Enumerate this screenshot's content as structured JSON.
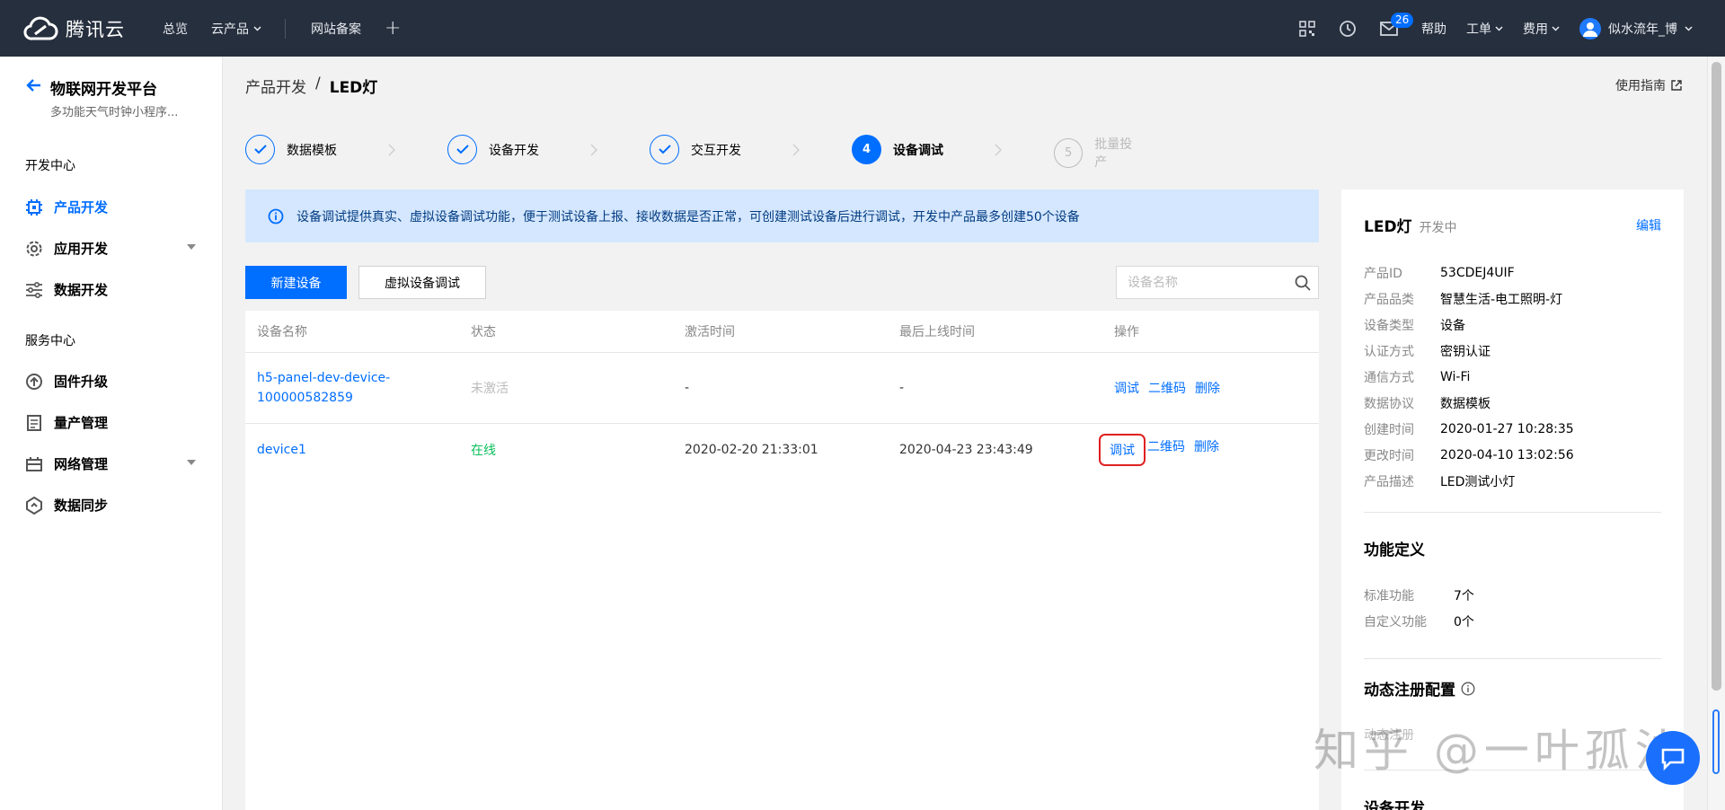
{
  "topbar": {
    "brand": "腾讯云",
    "nav": [
      "总览",
      "云产品",
      "网站备案"
    ],
    "mail_badge": "26",
    "help": "帮助",
    "ticket": "工单",
    "billing": "费用",
    "username": "似水流年_博"
  },
  "sidebar": {
    "title": "物联网开发平台",
    "subtitle": "多功能天气时钟小程序...",
    "section_dev": "开发中心",
    "items_dev": [
      "产品开发",
      "应用开发",
      "数据开发"
    ],
    "section_service": "服务中心",
    "items_service": [
      "固件升级",
      "量产管理",
      "网络管理",
      "数据同步"
    ]
  },
  "breadcrumb": {
    "parent": "产品开发",
    "sep": "/",
    "current": "LED灯"
  },
  "guide": "使用指南",
  "steps": [
    {
      "num": "1",
      "label": "数据模板",
      "state": "done"
    },
    {
      "num": "2",
      "label": "设备开发",
      "state": "done"
    },
    {
      "num": "3",
      "label": "交互开发",
      "state": "done"
    },
    {
      "num": "4",
      "label": "设备调试",
      "state": "current"
    },
    {
      "num": "5",
      "label": "批量投产",
      "state": "todo"
    }
  ],
  "notice": "设备调试提供真实、虚拟设备调试功能，便于测试设备上报、接收数据是否正常，可创建测试设备后进行调试，开发中产品最多创建50个设备",
  "buttons": {
    "new_device": "新建设备",
    "virtual_debug": "虚拟设备调试"
  },
  "search": {
    "placeholder": "设备名称",
    "value": ""
  },
  "table": {
    "columns": [
      "设备名称",
      "状态",
      "激活时间",
      "最后上线时间",
      "操作"
    ],
    "rows": [
      {
        "name_line1": "h5-panel-dev-device-",
        "name_line2": "100000582859",
        "status": "未激活",
        "activated": "-",
        "last_online": "-",
        "actions": [
          "调试",
          "二维码",
          "删除"
        ]
      },
      {
        "name_line1": "device1",
        "status": "在线",
        "activated": "2020-02-20 21:33:01",
        "last_online": "2020-04-23 23:43:49",
        "actions": [
          "调试",
          "二维码",
          "删除"
        ]
      }
    ]
  },
  "panel": {
    "name": "LED灯",
    "state": "开发中",
    "edit": "编辑",
    "props": [
      {
        "k": "产品ID",
        "v": "53CDEJ4UIF"
      },
      {
        "k": "产品品类",
        "v": "智慧生活-电工照明-灯"
      },
      {
        "k": "设备类型",
        "v": "设备"
      },
      {
        "k": "认证方式",
        "v": "密钥认证"
      },
      {
        "k": "通信方式",
        "v": "Wi-Fi"
      },
      {
        "k": "数据协议",
        "v": "数据模板"
      },
      {
        "k": "创建时间",
        "v": "2020-01-27 10:28:35"
      },
      {
        "k": "更改时间",
        "v": "2020-04-10 13:02:56"
      },
      {
        "k": "产品描述",
        "v": "LED测试小灯"
      }
    ],
    "func_title": "功能定义",
    "func_std_label": "标准功能",
    "func_std_val": "7个",
    "func_custom_label": "自定义功能",
    "func_custom_val": "0个",
    "dyn_title": "动态注册配置",
    "dyn_row": "动态注册",
    "dev_title": "设备开发"
  },
  "watermark": "知乎 @一叶孤沙"
}
